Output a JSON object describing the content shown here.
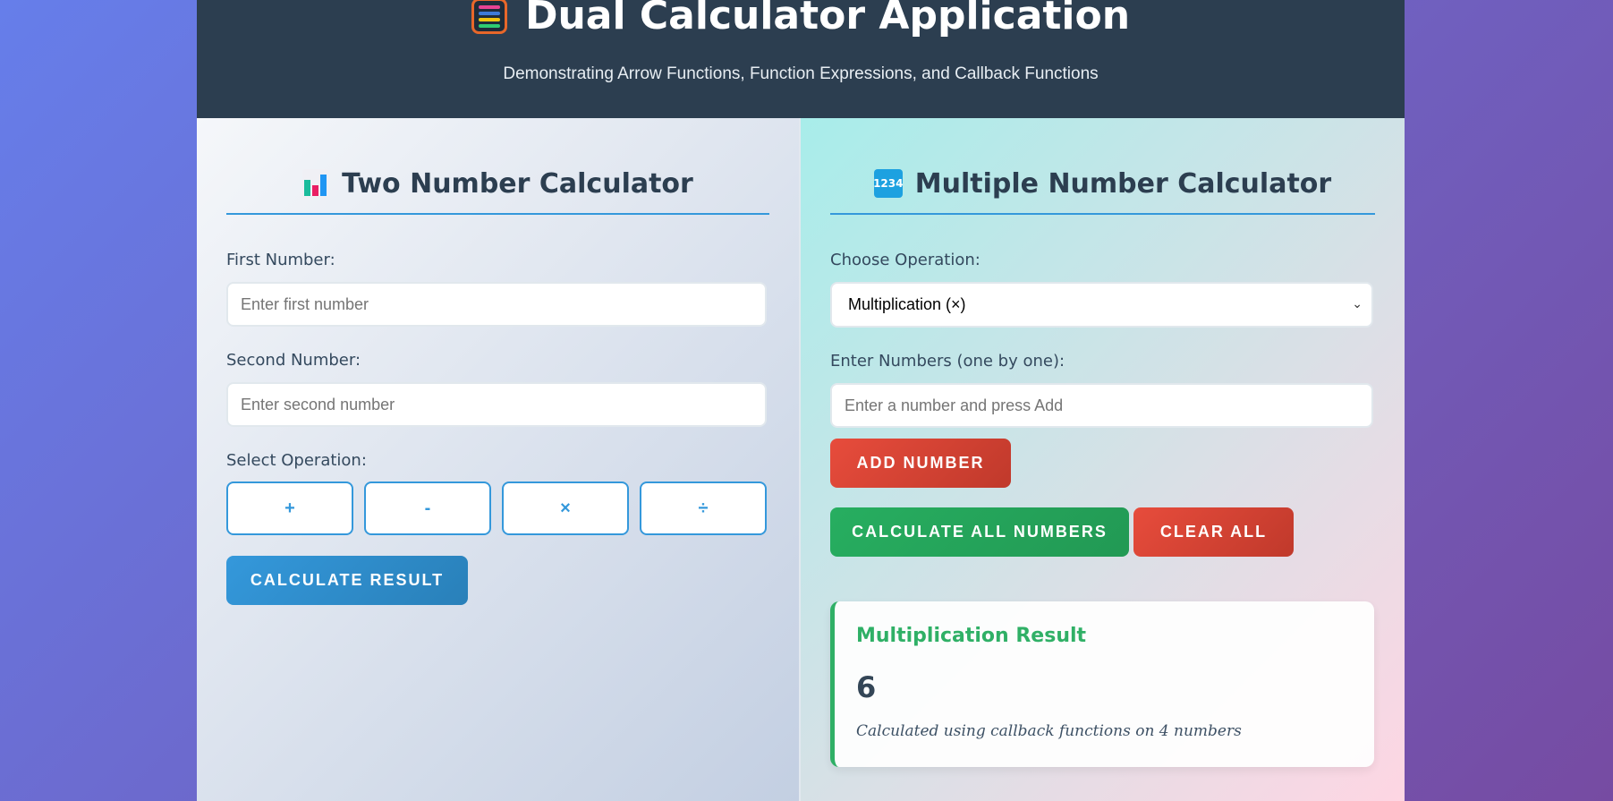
{
  "header": {
    "icon": "abacus-icon",
    "title": "Dual Calculator Application",
    "subtitle": "Demonstrating Arrow Functions, Function Expressions, and Callback Functions"
  },
  "two_calc": {
    "icon": "bar-chart-icon",
    "title": "Two Number Calculator",
    "first_label": "First Number:",
    "first_placeholder": "Enter first number",
    "first_value": "",
    "second_label": "Second Number:",
    "second_placeholder": "Enter second number",
    "second_value": "",
    "op_label": "Select Operation:",
    "ops": [
      "+",
      "-",
      "×",
      "÷"
    ],
    "calc_button": "Calculate Result"
  },
  "multi_calc": {
    "icon": "numbers-icon",
    "icon_text": "1234",
    "title": "Multiple Number Calculator",
    "op_label": "Choose Operation:",
    "op_selected": "Multiplication (×)",
    "numbers_label": "Enter Numbers (one by one):",
    "number_placeholder": "Enter a number and press Add",
    "number_value": "",
    "add_button": "Add Number",
    "calc_all_button": "Calculate All Numbers",
    "clear_button": "Clear All",
    "result": {
      "title": "Multiplication Result",
      "value": "6",
      "note": "Calculated using callback functions on 4 numbers"
    }
  },
  "colors": {
    "accent_blue": "#3498db",
    "danger_red": "#e74c3c",
    "success_green": "#27ae60",
    "header_bg": "#2c3e50"
  }
}
